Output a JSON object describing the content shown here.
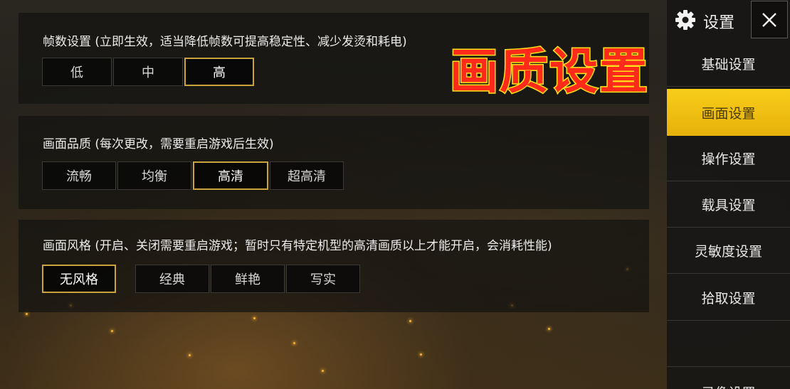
{
  "overlay_title": "画质设置",
  "sections": [
    {
      "title": "帧数设置 (立即生效，适当降低帧数可提高稳定性、减少发烫和耗电)",
      "options": [
        "低",
        "中",
        "高"
      ],
      "selected": "高"
    },
    {
      "title": "画面品质 (每次更改，需要重启游戏后生效)",
      "options": [
        "流畅",
        "均衡",
        "高清",
        "超高清"
      ],
      "selected": "高清"
    },
    {
      "title": "画面风格 (开启、关闭需要重启游戏；暂时只有特定机型的高清画质以上才能开启，会消耗性能)",
      "options": [
        "无风格",
        "经典",
        "鲜艳",
        "写实"
      ],
      "selected": "无风格"
    }
  ],
  "sidebar": {
    "header_label": "设置",
    "header_icon": "gear-icon",
    "close_icon": "close-icon",
    "items": [
      {
        "label": "基础设置"
      },
      {
        "label": "画面设置"
      },
      {
        "label": "操作设置"
      },
      {
        "label": "载具设置"
      },
      {
        "label": "灵敏度设置"
      },
      {
        "label": "拾取设置"
      },
      {
        "label": ""
      },
      {
        "label": "录像设置"
      }
    ],
    "active": "画面设置"
  },
  "colors": {
    "accent": "#f2c014",
    "selected_border": "#c9a43c",
    "overlay_fill": "#ff2a1a",
    "overlay_stroke": "#ffe21a"
  }
}
